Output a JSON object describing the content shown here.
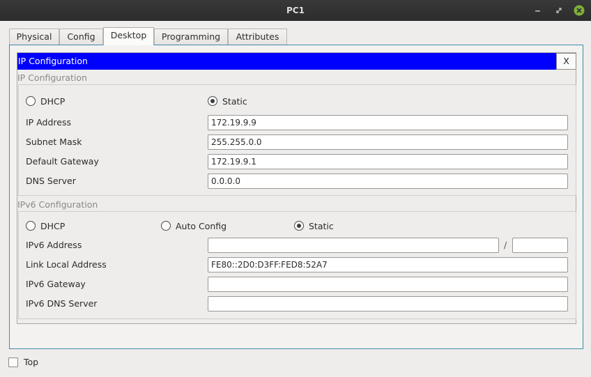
{
  "window": {
    "title": "PC1",
    "controls": [
      "minimize-icon",
      "restore-icon",
      "close-icon"
    ],
    "close_color": "#7fb13a"
  },
  "tabs": [
    {
      "label": "Physical",
      "active": false
    },
    {
      "label": "Config",
      "active": false
    },
    {
      "label": "Desktop",
      "active": true
    },
    {
      "label": "Programming",
      "active": false
    },
    {
      "label": "Attributes",
      "active": false
    }
  ],
  "ip_config": {
    "header_title": "IP Configuration",
    "header_color": "#0000ff",
    "close_label": "X",
    "ipv4": {
      "section_label": "IP Configuration",
      "dhcp_label": "DHCP",
      "static_label": "Static",
      "mode": "Static",
      "fields": {
        "ip_address": {
          "label": "IP Address",
          "value": "172.19.9.9"
        },
        "subnet_mask": {
          "label": "Subnet Mask",
          "value": "255.255.0.0"
        },
        "default_gateway": {
          "label": "Default Gateway",
          "value": "172.19.9.1"
        },
        "dns_server": {
          "label": "DNS Server",
          "value": "0.0.0.0"
        }
      }
    },
    "ipv6": {
      "section_label": "IPv6 Configuration",
      "dhcp_label": "DHCP",
      "auto_label": "Auto Config",
      "static_label": "Static",
      "mode": "Static",
      "fields": {
        "ipv6_address": {
          "label": "IPv6 Address",
          "value": "",
          "prefix": ""
        },
        "prefix_separator": "/",
        "link_local": {
          "label": "Link Local Address",
          "value": "FE80::2D0:D3FF:FED8:52A7"
        },
        "ipv6_gateway": {
          "label": "IPv6 Gateway",
          "value": ""
        },
        "ipv6_dns": {
          "label": "IPv6 DNS Server",
          "value": ""
        }
      }
    }
  },
  "footer": {
    "top_label": "Top",
    "top_checked": false
  }
}
